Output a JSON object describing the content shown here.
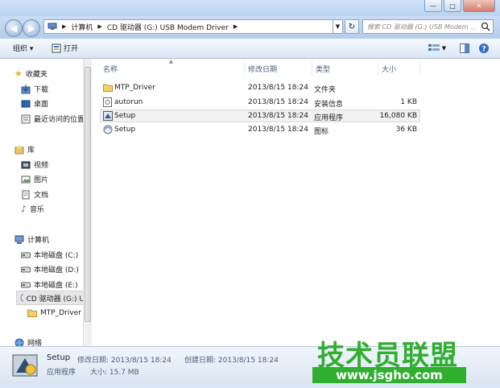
{
  "window": {
    "minimize": "—",
    "maximize": "□",
    "close": "✕"
  },
  "address": {
    "segments": [
      "计算机",
      "CD 驱动器 (G:) USB Modem Driver"
    ],
    "search_placeholder": "搜索 CD 驱动器 (G:) USB Modem ..."
  },
  "toolbar": {
    "organize_label": "组织 ▾",
    "open_label": "打开"
  },
  "sidebar": {
    "favorites": {
      "label": "收藏夹",
      "items": [
        "下载",
        "桌面",
        "最近访问的位置"
      ]
    },
    "libraries": {
      "label": "库",
      "items": [
        "视频",
        "图片",
        "文档",
        "音乐"
      ]
    },
    "computer": {
      "label": "计算机",
      "items": [
        "本地磁盘 (C:)",
        "本地磁盘 (D:)",
        "本地磁盘 (E:)",
        "CD 驱动器 (G:) U",
        "MTP_Driver"
      ]
    },
    "network": {
      "label": "网络"
    }
  },
  "columns": [
    "名称",
    "修改日期",
    "类型",
    "大小"
  ],
  "files": [
    {
      "name": "MTP_Driver",
      "date": "2013/8/15 18:24",
      "type": "文件夹",
      "size": "",
      "icon": "folder-icon"
    },
    {
      "name": "autorun",
      "date": "2013/8/15 18:24",
      "type": "安装信息",
      "size": "1 KB",
      "icon": "setup-info-icon"
    },
    {
      "name": "Setup",
      "date": "2013/8/15 18:24",
      "type": "应用程序",
      "size": "16,080 KB",
      "icon": "application-icon"
    },
    {
      "name": "Setup",
      "date": "2013/8/15 18:24",
      "type": "图标",
      "size": "36 KB",
      "icon": "icon-file-icon"
    }
  ],
  "details": {
    "name": "Setup",
    "modified": "修改日期: 2013/8/15 18:24",
    "created": "创建日期: 2013/8/15 18:24",
    "type": "应用程序",
    "size": "大小: 15.7 MB"
  },
  "watermark": {
    "title": "技术员联盟",
    "url": "www.jsgho.com"
  },
  "colors": {
    "accent": "#2fae2f",
    "titlebar": "#bcd4ef"
  }
}
